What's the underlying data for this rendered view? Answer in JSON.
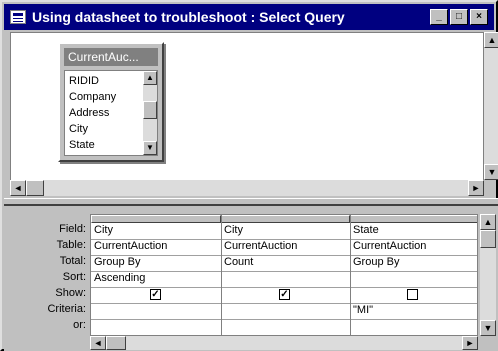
{
  "window": {
    "title": "Using datasheet to troubleshoot : Select Query",
    "minimize_glyph": "_",
    "maximize_glyph": "□",
    "close_glyph": "×"
  },
  "table_list": {
    "title": "CurrentAuc...",
    "fields": [
      "RIDID",
      "Company",
      "Address",
      "City",
      "State"
    ]
  },
  "grid": {
    "row_labels": {
      "field": "Field:",
      "table": "Table:",
      "total": "Total:",
      "sort": "Sort:",
      "show": "Show:",
      "criteria": "Criteria:",
      "or": "or:"
    },
    "columns": [
      {
        "field": "City",
        "table": "CurrentAuction",
        "total": "Group By",
        "sort": "Ascending",
        "show": true,
        "criteria": ""
      },
      {
        "field": "City",
        "table": "CurrentAuction",
        "total": "Count",
        "sort": "",
        "show": true,
        "criteria": ""
      },
      {
        "field": "State",
        "table": "CurrentAuction",
        "total": "Group By",
        "sort": "",
        "show": false,
        "criteria": "\"MI\""
      }
    ]
  },
  "icons": {
    "up": "▲",
    "down": "▼",
    "left": "◄",
    "right": "►",
    "check": "✓"
  }
}
